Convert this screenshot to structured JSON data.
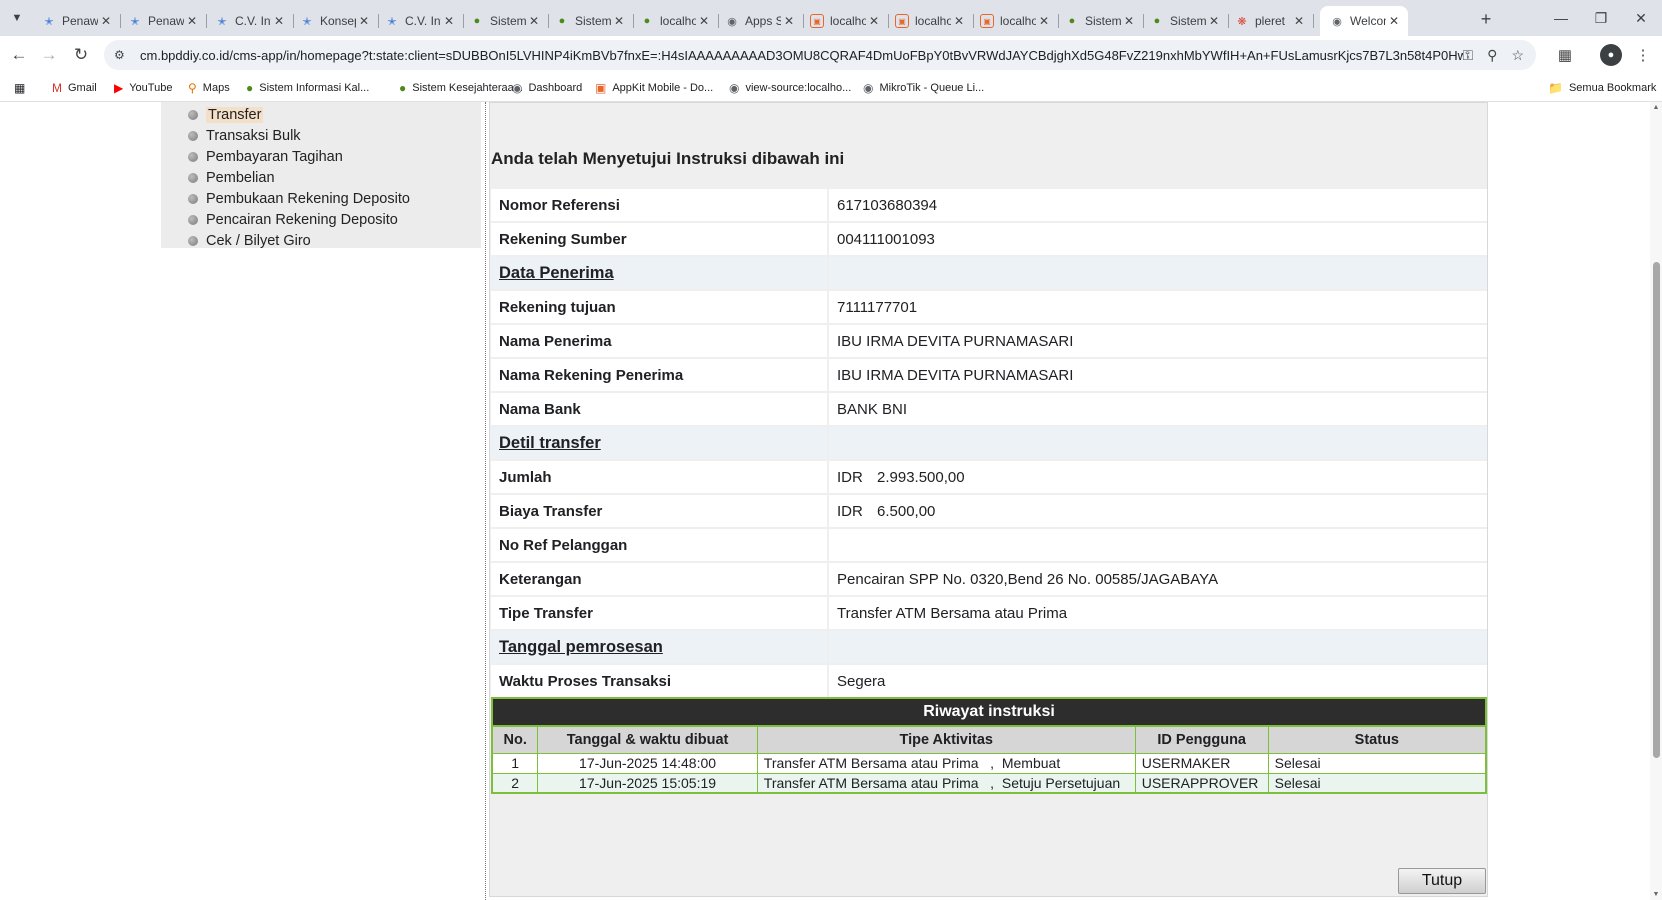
{
  "browser": {
    "tabs": [
      {
        "title": "Penawaran",
        "icon": "star-icon",
        "active": false
      },
      {
        "title": "Penawaran",
        "icon": "star-icon",
        "active": false
      },
      {
        "title": "C.V. Infinity",
        "icon": "star-icon",
        "active": false
      },
      {
        "title": "Konsep",
        "icon": "star-icon",
        "active": false
      },
      {
        "title": "C.V. Infinity",
        "icon": "star-icon",
        "active": false
      },
      {
        "title": "Sistem",
        "icon": "emblem-icon",
        "active": false
      },
      {
        "title": "Sistem",
        "icon": "emblem-icon",
        "active": false
      },
      {
        "title": "localhost",
        "icon": "emblem-icon",
        "active": false
      },
      {
        "title": "Apps Script",
        "icon": "globe-icon",
        "active": false
      },
      {
        "title": "localhost",
        "icon": "appkit-icon",
        "active": false
      },
      {
        "title": "localhost",
        "icon": "appkit-icon",
        "active": false
      },
      {
        "title": "localhost",
        "icon": "appkit-icon",
        "active": false
      },
      {
        "title": "Sistem",
        "icon": "emblem-icon",
        "active": false
      },
      {
        "title": "Sistem",
        "icon": "emblem-icon",
        "active": false
      },
      {
        "title": "pleret",
        "icon": "multicolor-icon",
        "active": false
      },
      {
        "title": "Welcome",
        "icon": "globe-icon",
        "active": true
      }
    ],
    "url": "cm.bpddiy.co.id/cms-app/in/homepage?t:state:client=sDUBBOnI5LVHINP4iKmBVb7fnxE=:H4sIAAAAAAAAAD3OMU8CQRAF4DmUoFBpY0tBvVRWdJAYCBdjghXd5G48FvZ219nxhMbYWfIH+An+FUsLamusrKjcs7B7L3n58t4P0Hw+BYAkMEwdFwo9Z...",
    "bookmarks": [
      {
        "label": "Gmail",
        "icon": "gmail-icon"
      },
      {
        "label": "YouTube",
        "icon": "youtube-icon"
      },
      {
        "label": "Maps",
        "icon": "maps-pin-icon"
      },
      {
        "label": "Sistem Informasi Kal...",
        "icon": "emblem-icon"
      },
      {
        "label": "Sistem Kesejahteraa...",
        "icon": "emblem-icon"
      },
      {
        "label": "Dashboard",
        "icon": "globe-icon"
      },
      {
        "label": "AppKit Mobile - Do...",
        "icon": "appkit-icon"
      },
      {
        "label": "view-source:localho...",
        "icon": "globe-icon"
      },
      {
        "label": "MikroTik - Queue Li...",
        "icon": "globe-icon"
      }
    ],
    "all_bookmarks_label": "Semua Bookmark"
  },
  "sidebar": {
    "items": [
      {
        "label": "Transfer",
        "active": true
      },
      {
        "label": "Transaksi Bulk",
        "active": false
      },
      {
        "label": "Pembayaran Tagihan",
        "active": false
      },
      {
        "label": "Pembelian",
        "active": false
      },
      {
        "label": "Pembukaan Rekening Deposito",
        "active": false
      },
      {
        "label": "Pencairan Rekening Deposito",
        "active": false
      },
      {
        "label": "Cek / Bilyet Giro",
        "active": false
      }
    ]
  },
  "main": {
    "heading": "Anda telah Menyetujui Instruksi dibawah ini",
    "details": [
      {
        "label": "Nomor Referensi",
        "value": "617103680394"
      },
      {
        "label": "Rekening Sumber",
        "value": "004111001093"
      },
      {
        "label": "Data Penerima",
        "value": "",
        "section": true
      },
      {
        "label": "Rekening tujuan",
        "value": "7111177701"
      },
      {
        "label": "Nama Penerima",
        "value": "IBU IRMA DEVITA PURNAMASARI"
      },
      {
        "label": "Nama Rekening Penerima",
        "value": "IBU IRMA DEVITA PURNAMASARI"
      },
      {
        "label": "Nama Bank",
        "value": "BANK BNI"
      },
      {
        "label": "Detil transfer",
        "value": "",
        "section": true
      },
      {
        "label": "Jumlah",
        "currency": "IDR",
        "value": "2.993.500,00"
      },
      {
        "label": "Biaya Transfer",
        "currency": "IDR",
        "value": "6.500,00"
      },
      {
        "label": "No Ref Pelanggan",
        "value": ""
      },
      {
        "label": "Keterangan",
        "value": "Pencairan SPP No. 0320,Bend 26 No. 00585/JAGABAYA"
      },
      {
        "label": "Tipe Transfer",
        "value": "Transfer ATM Bersama atau Prima"
      },
      {
        "label": "Tanggal pemrosesan",
        "value": "",
        "section": true
      },
      {
        "label": "Waktu Proses Transaksi",
        "value": "Segera"
      }
    ],
    "history": {
      "title": "Riwayat instruksi",
      "columns": [
        "No.",
        "Tanggal & waktu dibuat",
        "Tipe Aktivitas",
        "ID Pengguna",
        "Status"
      ],
      "rows": [
        {
          "no": "1",
          "datetime": "17-Jun-2025 14:48:00",
          "activity": "Transfer ATM Bersama atau Prima   ,  Membuat",
          "user": "USERMAKER",
          "status": "Selesai"
        },
        {
          "no": "2",
          "datetime": "17-Jun-2025 15:05:19",
          "activity": "Transfer ATM Bersama atau Prima   ,  Setuju Persetujuan",
          "user": "USERAPPROVER",
          "status": "Selesai"
        }
      ]
    },
    "close_label": "Tutup"
  }
}
